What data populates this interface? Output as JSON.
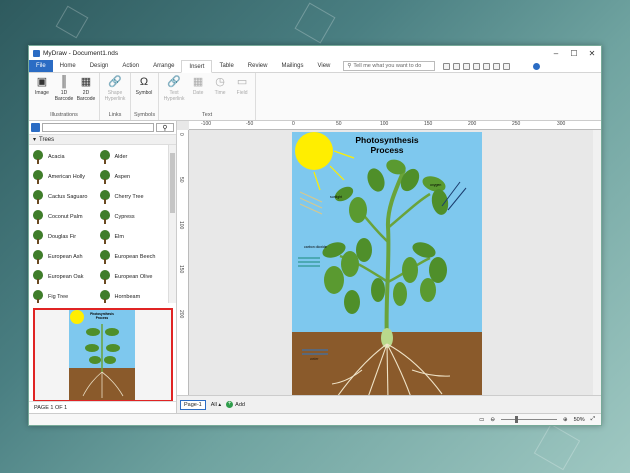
{
  "window": {
    "title": "MyDraw - Document1.nds"
  },
  "tabs": [
    "File",
    "Home",
    "Design",
    "Action",
    "Arrange",
    "Insert",
    "Table",
    "Review",
    "Mailings",
    "View"
  ],
  "tell_me": {
    "placeholder": "Tell me what you want to do"
  },
  "ribbon": {
    "illustrations": {
      "label": "Illustrations",
      "items": [
        "Image",
        "1D Barcode",
        "2D Barcode"
      ]
    },
    "links": {
      "label": "Links",
      "items": [
        "Shape Hyperlink"
      ]
    },
    "symbols": {
      "label": "Symbols",
      "items": [
        "Symbol"
      ]
    },
    "text": {
      "label": "Text",
      "items": [
        "Text Hyperlink",
        "Date",
        "Time",
        "Field"
      ]
    }
  },
  "shapes_panel": {
    "category": "Trees",
    "items": [
      "Acacia",
      "Alder",
      "American Holly",
      "Aspen",
      "Cactus Saguaro",
      "Cherry Tree",
      "Coconut Palm",
      "Cypress",
      "Douglas Fir",
      "Elm",
      "European Ash",
      "European Beech",
      "European Oak",
      "European Olive",
      "Fig Tree",
      "Hornbeam"
    ]
  },
  "ruler": {
    "h": [
      "-100",
      "-50",
      "0",
      "50",
      "100",
      "150",
      "200",
      "250",
      "300"
    ],
    "v": [
      "0",
      "50",
      "100",
      "150",
      "200"
    ]
  },
  "diagram": {
    "title_line1": "Photosynthesis",
    "title_line2": "Process",
    "labels": {
      "sunlight": "sunlight",
      "oxygen": "oxygen",
      "carbon_dioxide": "carbon dioxide",
      "water": "water"
    }
  },
  "pagebar": {
    "page_tab": "Page-1",
    "all": "All ▴",
    "add": "Add"
  },
  "status": {
    "page": "PAGE 1 OF 1",
    "zoom": "50%"
  },
  "colors": {
    "sky": "#7ec8ee",
    "soil": "#8a5a2b",
    "sun": "#ffee00",
    "leaf": "#4f8f2a",
    "accent": "#2b6cc4",
    "preview_border": "#e02424"
  }
}
